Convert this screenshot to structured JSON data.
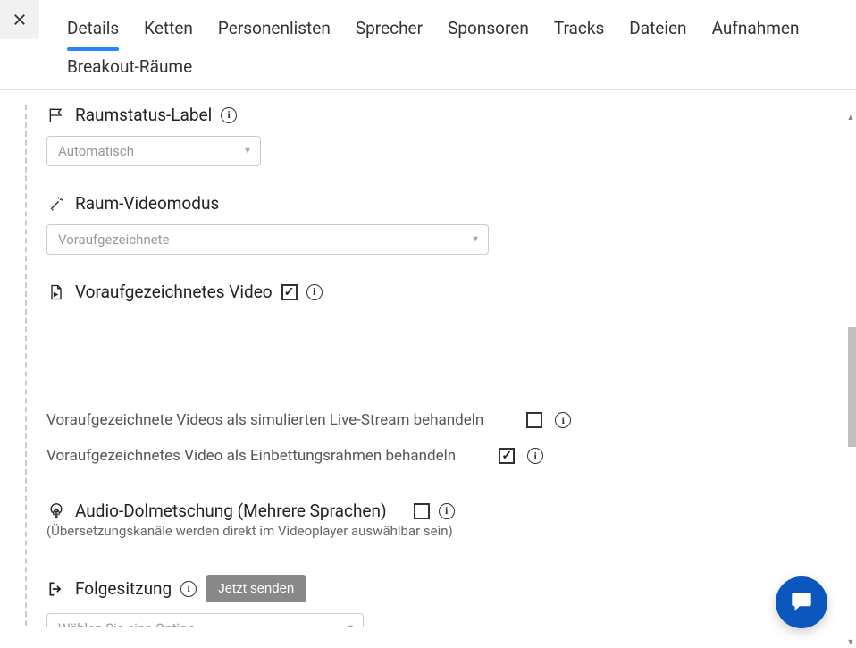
{
  "tabs": {
    "details": "Details",
    "ketten": "Ketten",
    "personen": "Personenlisten",
    "sprecher": "Sprecher",
    "sponsoren": "Sponsoren",
    "tracks": "Tracks",
    "dateien": "Dateien",
    "aufnahmen": "Aufnahmen",
    "breakout": "Breakout-Räume"
  },
  "sections": {
    "raumstatus": {
      "title": "Raumstatus-Label",
      "select": "Automatisch"
    },
    "videomodus": {
      "title": "Raum-Videomodus",
      "select": "Voraufgezeichnete"
    },
    "voraufgezeichnet": {
      "title": "Voraufgezeichnetes Video"
    },
    "livestream": {
      "label": "Voraufgezeichnete Videos als simulierten Live-Stream behandeln"
    },
    "einbettung": {
      "label": "Voraufgezeichnetes Video als Einbettungsrahmen behandeln"
    },
    "audio": {
      "title": "Audio-Dolmetschung (Mehrere Sprachen)",
      "subtext": "(Übersetzungskanäle werden direkt im Videoplayer auswählbar sein)"
    },
    "folgesitzung": {
      "title": "Folgesitzung",
      "button": "Jetzt senden",
      "select": "Wählen Sie eine Option"
    }
  },
  "info_glyph": "i"
}
